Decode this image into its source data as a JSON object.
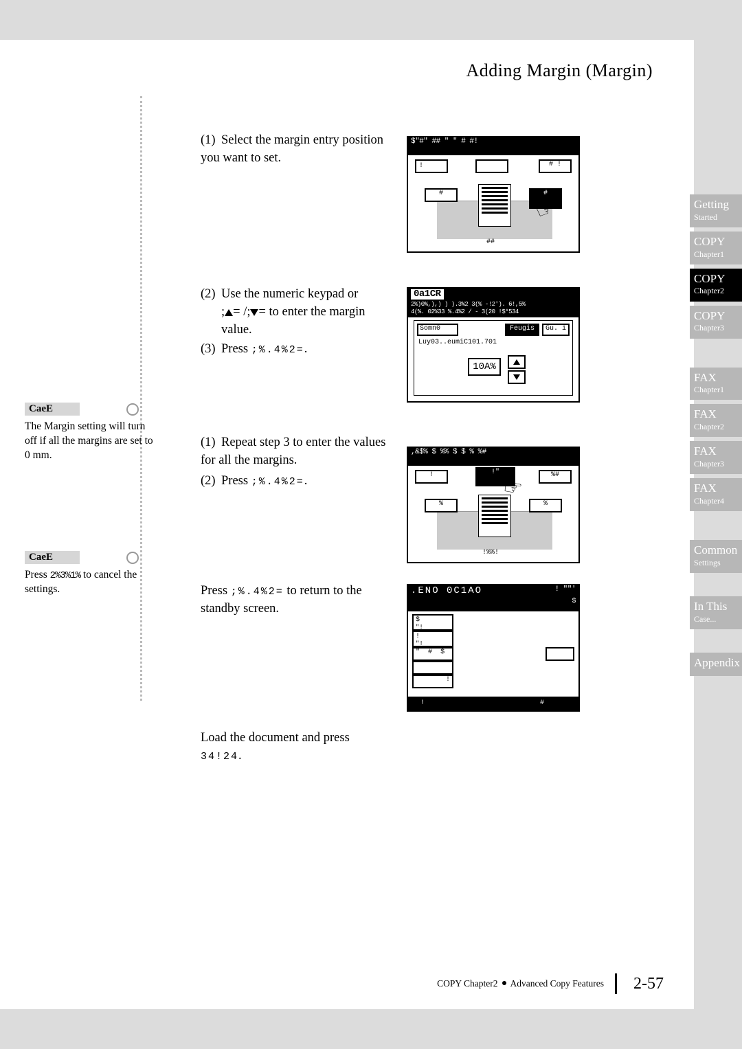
{
  "header": {
    "title": "Adding Margin (Margin)"
  },
  "tabs": [
    {
      "line1": "Getting",
      "line2": "Started",
      "active": false
    },
    {
      "line1": "COPY",
      "line2": "Chapter1",
      "active": false
    },
    {
      "line1": "COPY",
      "line2": "Chapter2",
      "active": true
    },
    {
      "line1": "COPY",
      "line2": "Chapter3",
      "active": false
    },
    {
      "gap": true
    },
    {
      "line1": "FAX",
      "line2": "Chapter1",
      "active": false
    },
    {
      "line1": "FAX",
      "line2": "Chapter2",
      "active": false
    },
    {
      "line1": "FAX",
      "line2": "Chapter3",
      "active": false
    },
    {
      "line1": "FAX",
      "line2": "Chapter4",
      "active": false
    },
    {
      "gap": true
    },
    {
      "line1": "Common",
      "line2": "Settings",
      "active": false
    },
    {
      "gap2": true
    },
    {
      "line1": "In This",
      "line2": "Case...",
      "active": false
    },
    {
      "gap2": true
    },
    {
      "line1": "Appendix",
      "line2": "",
      "active": false
    }
  ],
  "notes": {
    "label": "CaeE",
    "note1_text": "The Margin setting will turn off if all the margins are set to 0 mm.",
    "note2_prefix": "Press ",
    "note2_key": "2%3%1%",
    "note2_suffix": " to cancel the settings."
  },
  "steps": {
    "s1": {
      "num": "(1)",
      "text": "Select the margin entry position you want to set."
    },
    "s2": {
      "num": "(2)",
      "pre": "Use the numeric keypad or",
      "arrows": ";▲=/;▼=",
      "post": " to enter the margin value."
    },
    "s3": {
      "num": "(3)",
      "pre": "Press ",
      "key": ";%.4%2="
    },
    "s4": {
      "num": "(1)",
      "text": "Repeat step 3 to enter the values for all the margins."
    },
    "s5": {
      "num": "(2)",
      "pre": "Press ",
      "key": ";%.4%2="
    },
    "s6": {
      "pre": "Press ",
      "key": ";%.4%2=",
      "post": " to return to the standby screen."
    },
    "s7": {
      "pre": "Load the document and press ",
      "key": "34!24"
    }
  },
  "lcd1": {
    "top": "$\"#\" ##  \"  \"  #  #!",
    "label_top": "!",
    "label_right": "# !",
    "label_left2": "#",
    "label_right2": "#",
    "label_bottom": "##"
  },
  "lcd2": {
    "title": "0a1CR",
    "sub1": "2%)0%,),)  )   ).3%2 3(% -!2'). 6!,5%",
    "sub2": "4(%. 02%33 %.4%2 / - 3(20  !$*534  ",
    "tab1": "Somn0",
    "tab_sel": "Feugis",
    "tab3": "Gu. i",
    "range": "Luy03..eumiC101.701",
    "val": "10A%"
  },
  "lcd3": {
    "top": ",&$% $ %%  $  $  %  %#",
    "label_tr": "%#",
    "label_top_center": "!\"",
    "label_left": "%",
    "label_right": "%",
    "label_bottom": "!%%!"
  },
  "lcd4": {
    "title": ".ENO 0C1AO",
    "topright": "!    \"\"'",
    "col_hdr": "$",
    "r1": "$",
    "r1b": "\"!",
    "r2": "!",
    "r2b": "\"!",
    "r3": "\"",
    "r3b": "#",
    "r3c": "$",
    "r5": "!",
    "foot_l": "!",
    "foot_r": "#"
  },
  "footer": {
    "text": "COPY Chapter2",
    "section": "Advanced Copy Features",
    "page": "2-57"
  }
}
